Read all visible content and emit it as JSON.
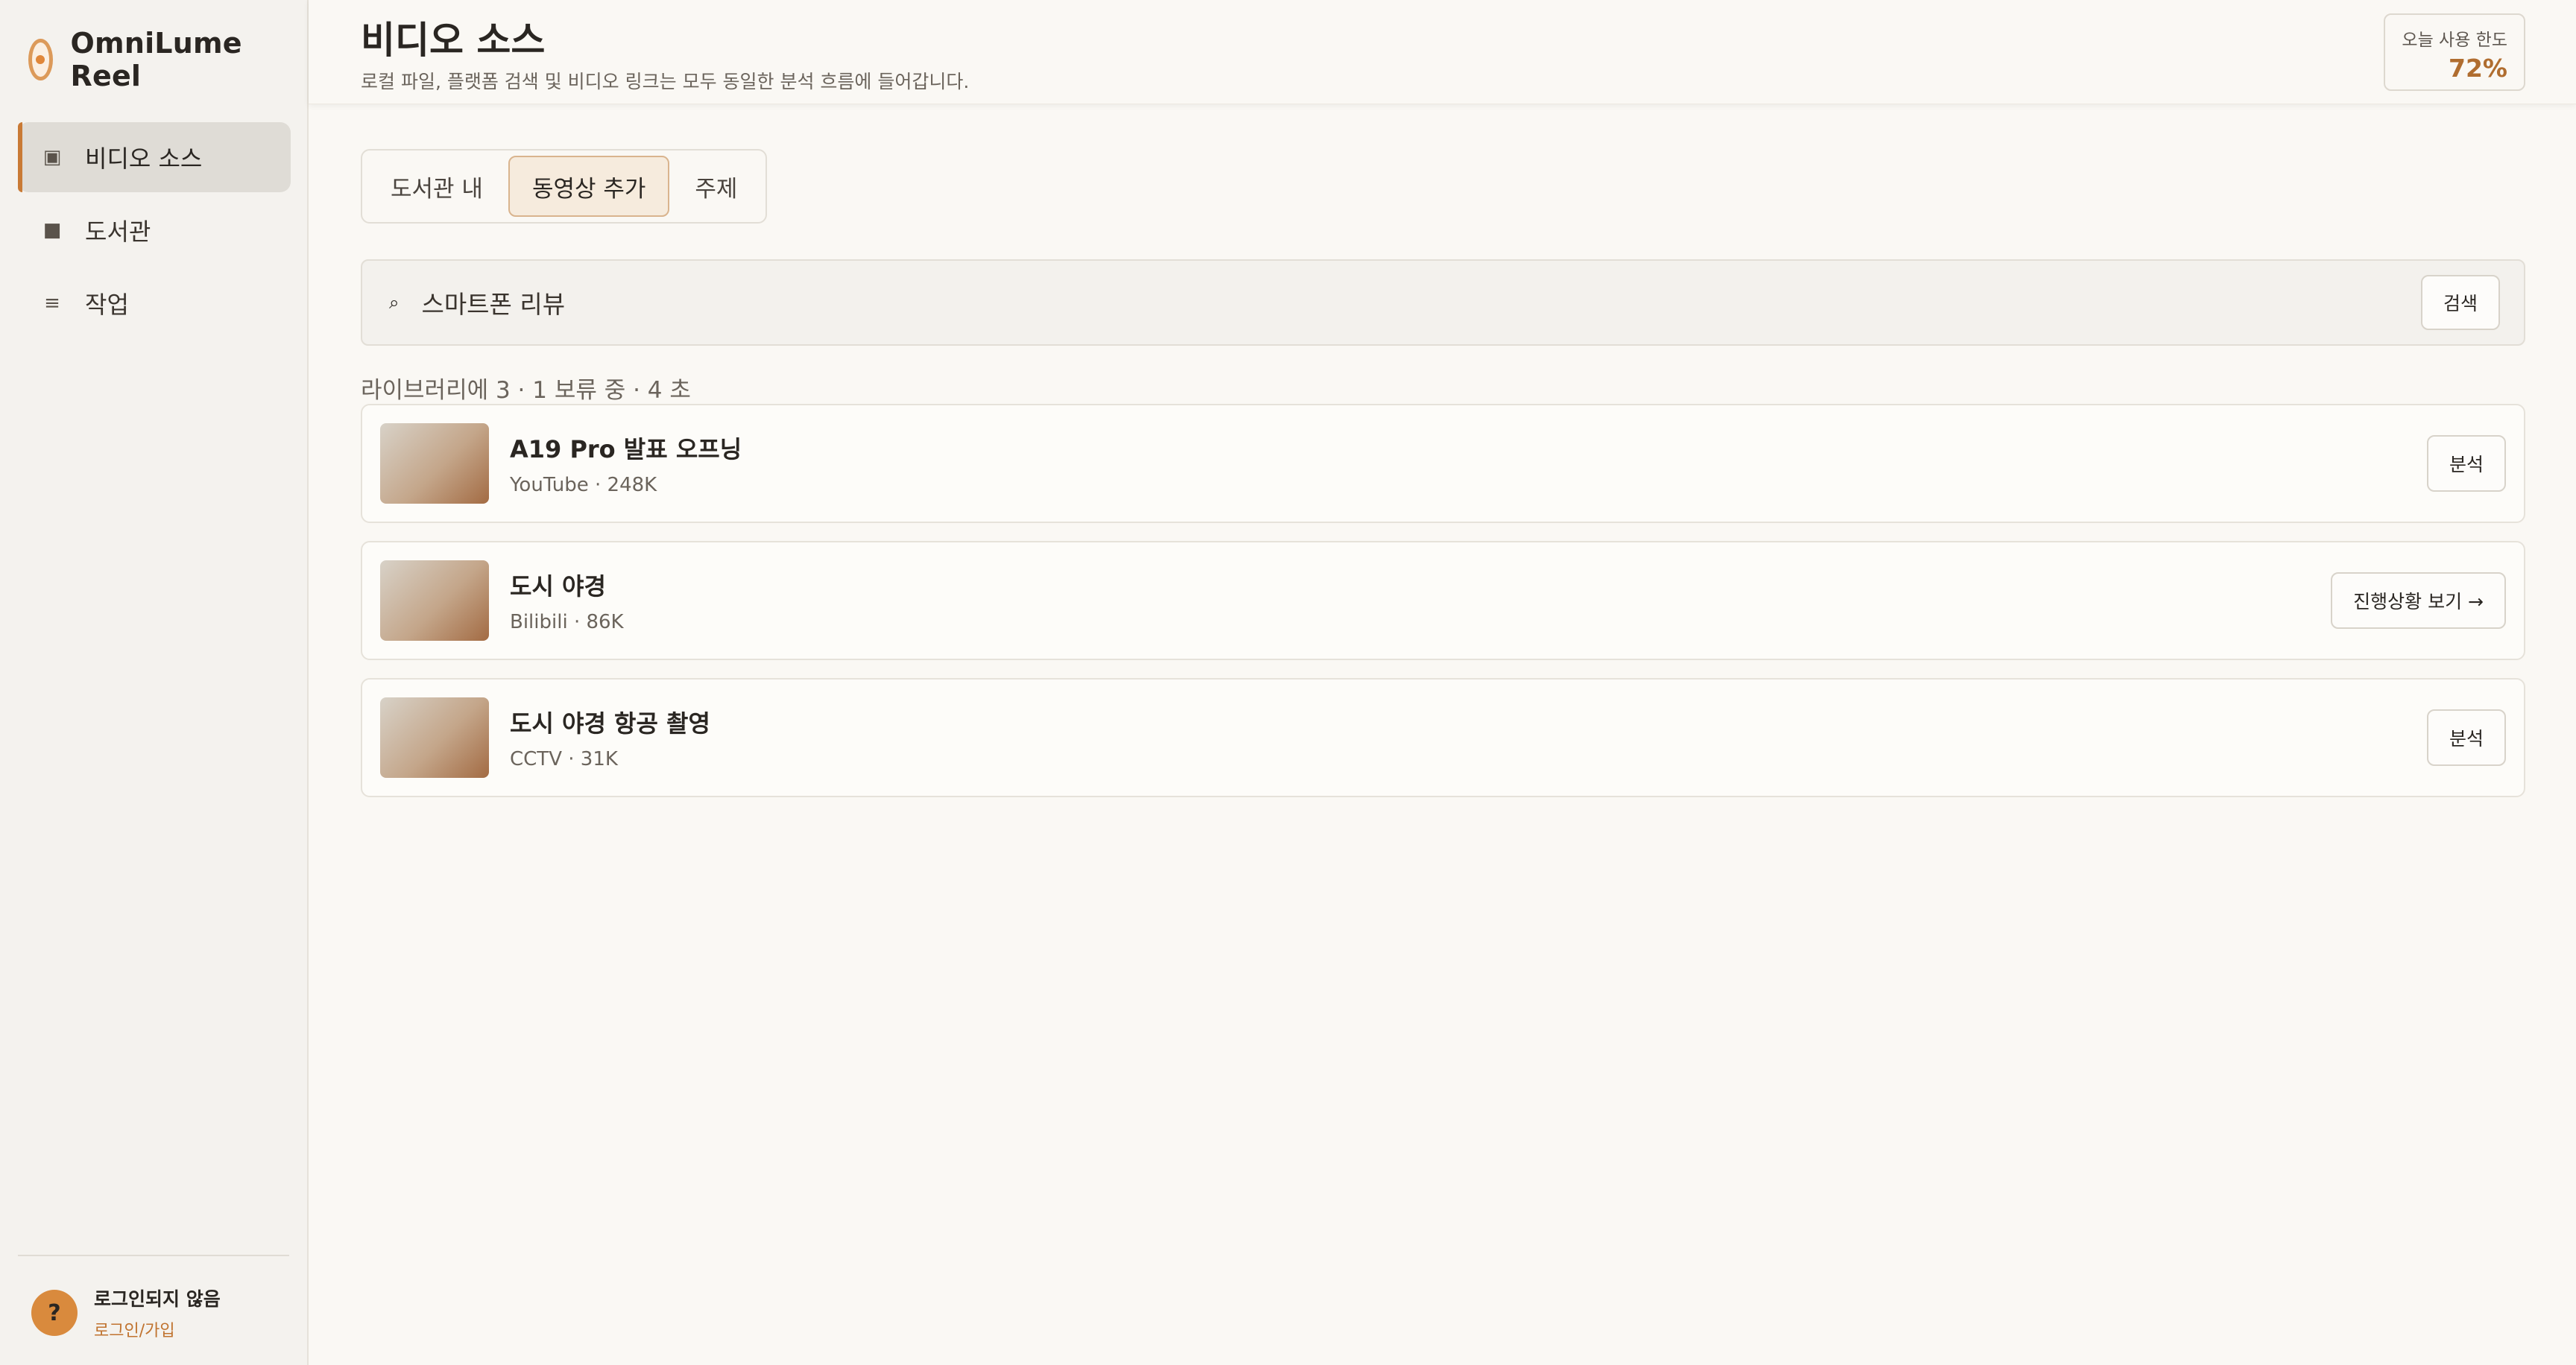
{
  "app": {
    "name": "OmniLume Reel"
  },
  "sidebar": {
    "items": [
      {
        "label": "비디오 소스",
        "icon": "▣",
        "icon_name": "video-source-icon",
        "active": true
      },
      {
        "label": "도서관",
        "icon": "■",
        "icon_name": "library-icon",
        "active": false
      },
      {
        "label": "작업",
        "icon": "≡",
        "icon_name": "tasks-icon",
        "active": false
      }
    ],
    "user": {
      "avatar": "?",
      "status": "로그인되지 않음",
      "login_link": "로그인/가입"
    }
  },
  "header": {
    "title": "비디오 소스",
    "subtitle": "로컬 파일, 플랫폼 검색 및 비디오 링크는 모두 동일한 분석 흐름에 들어갑니다.",
    "quota": {
      "label": "오늘 사용 한도",
      "value": "72%"
    }
  },
  "tabs": [
    {
      "label": "도서관 내",
      "active": false
    },
    {
      "label": "동영상 추가",
      "active": true
    },
    {
      "label": "주제",
      "active": false
    }
  ],
  "search": {
    "icon": "⌕",
    "value": "스마트폰 리뷰",
    "button_label": "검색"
  },
  "summary": "라이브러리에 3 · 1 보류 중 · 4 초",
  "results": [
    {
      "title": "A19 Pro 발표 오프닝",
      "meta": "YouTube · 248K",
      "action": "분석"
    },
    {
      "title": "도시 야경",
      "meta": "Bilibili · 86K",
      "action": "진행상황 보기 →"
    },
    {
      "title": "도시 야경 항공 촬영",
      "meta": "CCTV · 31K",
      "action": "분석"
    }
  ],
  "colors": {
    "accent": "#c97a35",
    "quota": "#b06d2f",
    "link": "#c0732f"
  }
}
